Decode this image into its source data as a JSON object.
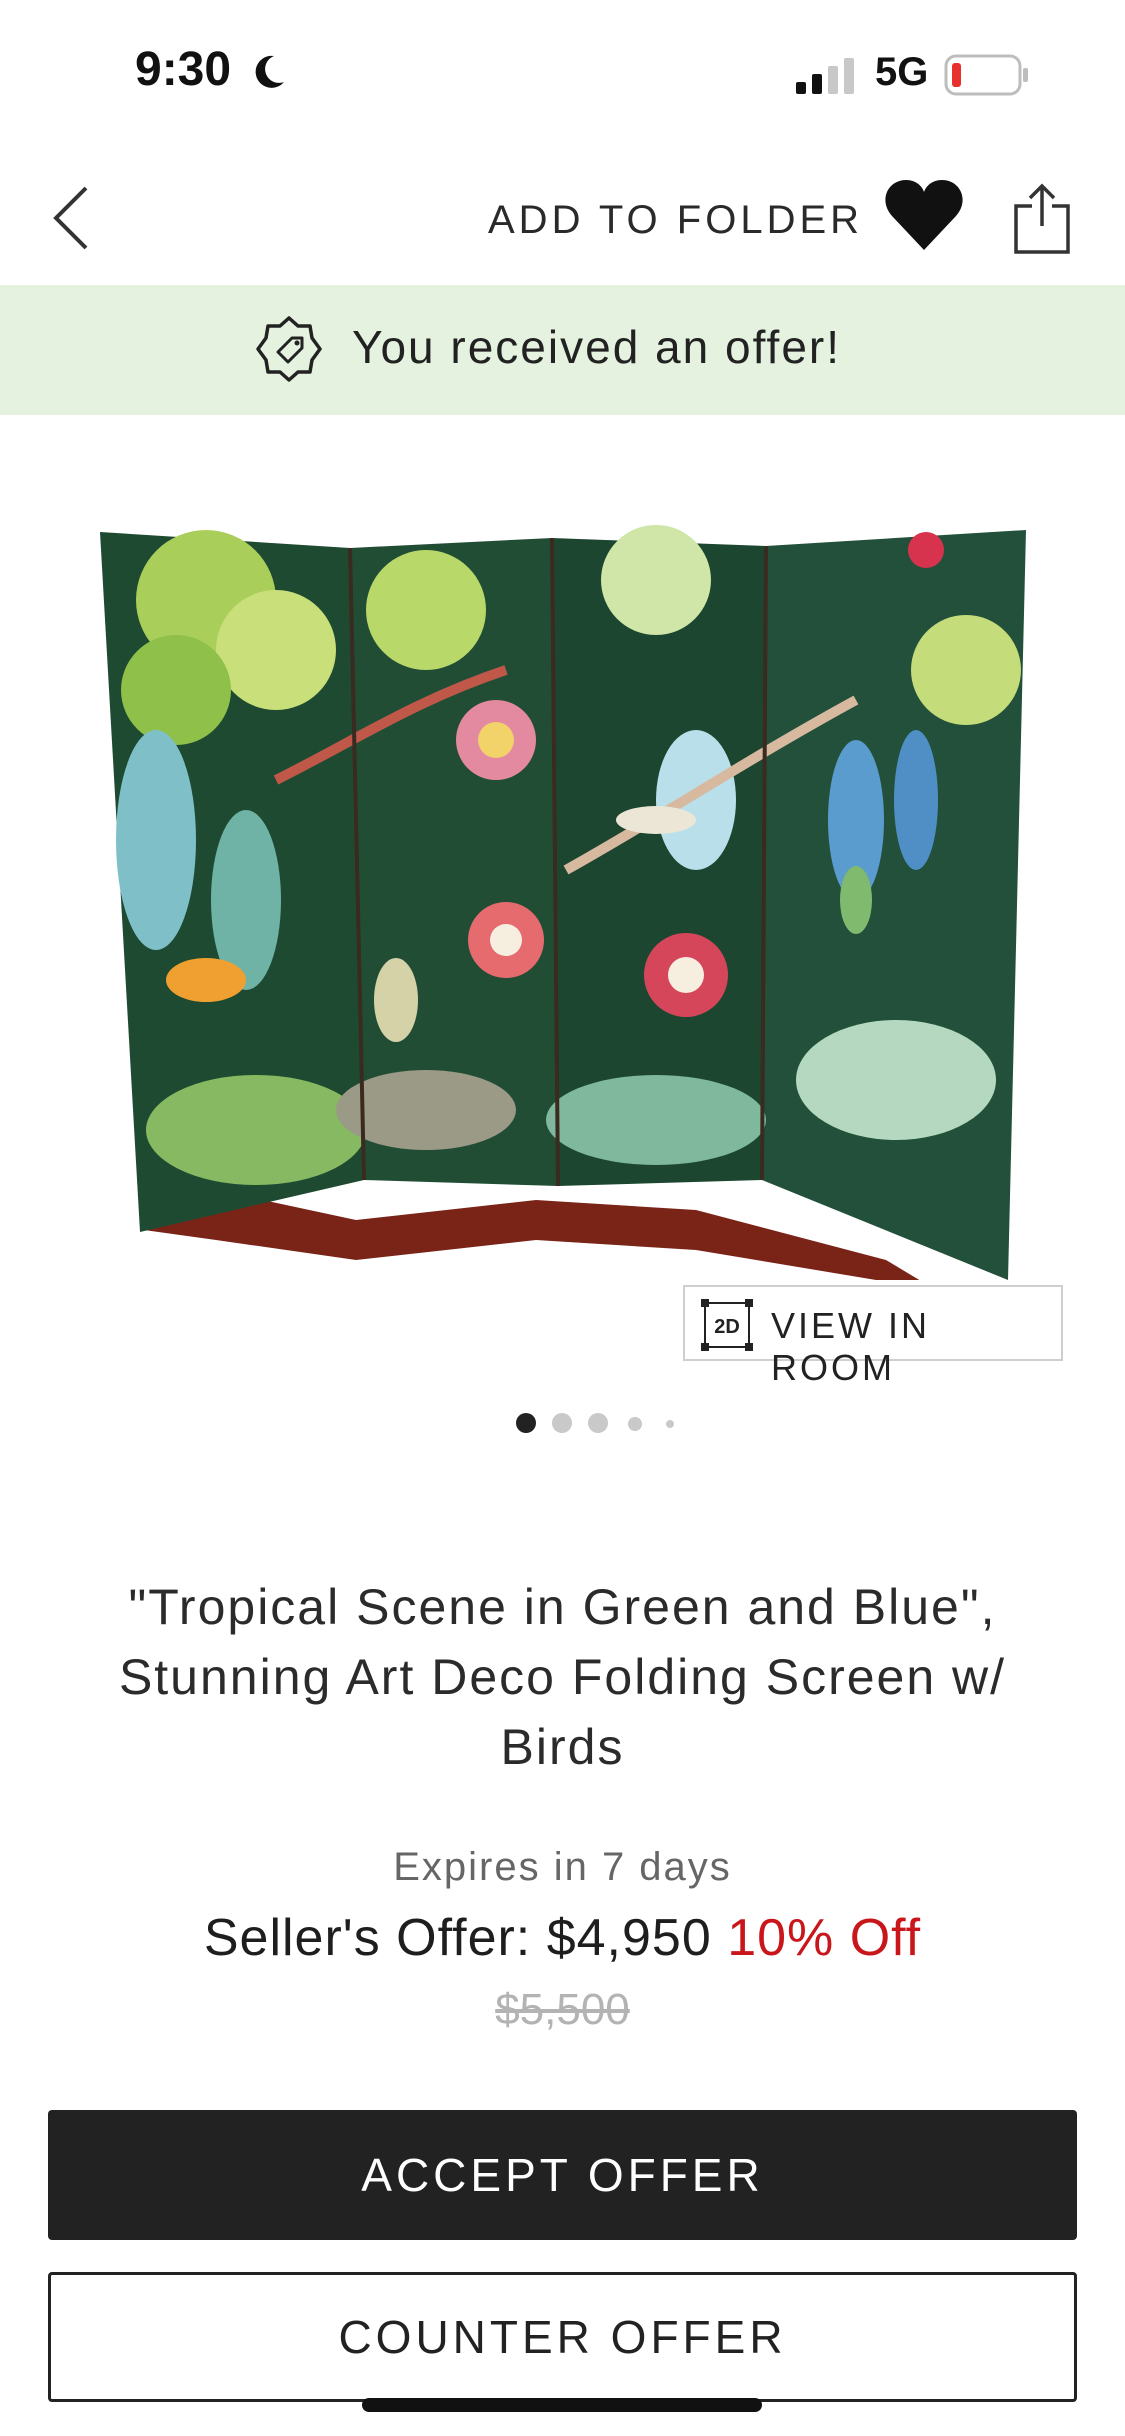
{
  "status_bar": {
    "time": "9:30",
    "network": "5G"
  },
  "nav": {
    "add_to_folder": "ADD TO FOLDER"
  },
  "banner": {
    "text": "You received an offer!"
  },
  "product": {
    "image_alt": "Art Deco folding screen with tropical birds",
    "view_in_room_badge": "2D",
    "view_in_room": "VIEW IN ROOM",
    "title_line1": "\"Tropical Scene in Green and Blue\",",
    "title_line2": "Stunning Art Deco Folding Screen w/",
    "title_line3": "Birds",
    "image_count_dots": 5,
    "active_image_index": 0
  },
  "offer": {
    "expires": "Expires in 7 days",
    "label": "Seller's Offer: $4,950",
    "discount": "10% Off",
    "original_price": "$5,500"
  },
  "actions": {
    "accept": "ACCEPT OFFER",
    "counter": "COUNTER OFFER"
  },
  "colors": {
    "banner_bg": "#e5f2df",
    "accent_red": "#c9161b",
    "dark": "#222222"
  },
  "icons": [
    "moon-icon",
    "signal-icon",
    "battery-icon",
    "back-chevron-icon",
    "heart-icon",
    "share-icon",
    "price-tag-icon",
    "2d-view-icon"
  ]
}
